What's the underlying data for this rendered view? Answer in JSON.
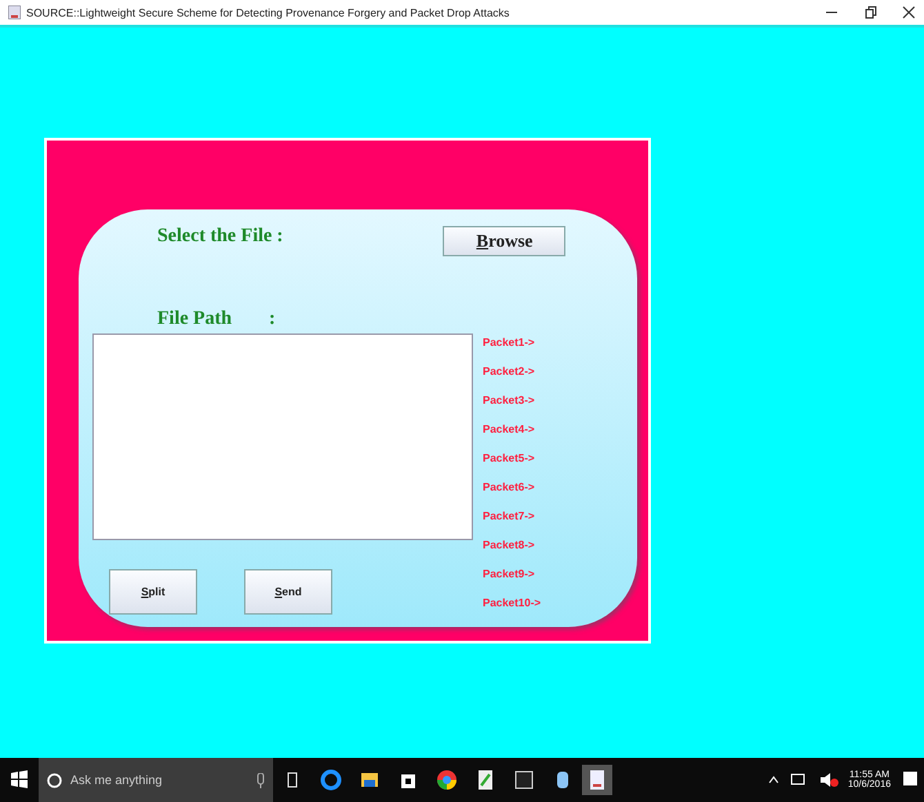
{
  "window": {
    "title": "SOURCE::Lightweight Secure Scheme for Detecting Provenance Forgery and Packet Drop Attacks"
  },
  "form": {
    "select_label": "Select the File :",
    "browse_button": "Browse",
    "path_label": "File Path",
    "path_colon": ":",
    "packets": [
      "Packet1->",
      "Packet2->",
      "Packet3->",
      "Packet4->",
      "Packet5->",
      "Packet6->",
      "Packet7->",
      "Packet8->",
      "Packet9->",
      "Packet10->"
    ],
    "buttons": [
      "Split",
      "Send"
    ]
  },
  "taskbar": {
    "search_placeholder": "Ask me anything",
    "time": "11:55 AM",
    "date": "10/6/2016"
  }
}
